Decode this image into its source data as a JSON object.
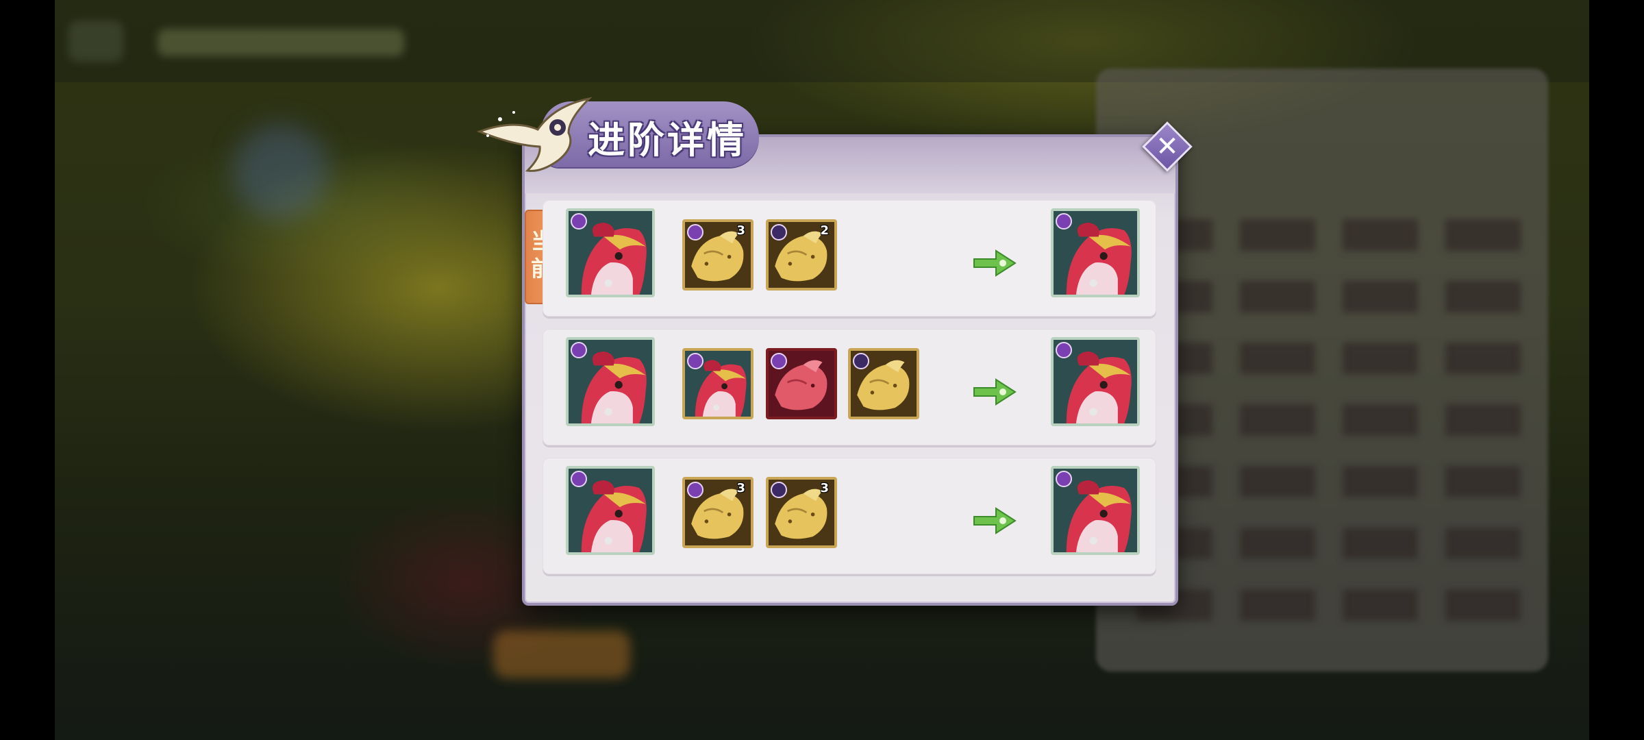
{
  "dialog": {
    "title": "进阶详情",
    "current_tag": "当前",
    "close_icon": "close-x-icon"
  },
  "rows": [
    {
      "is_current": true,
      "source_pet": "red-hood-bird-pet",
      "materials": [
        {
          "item": "gold-spirit-fox",
          "count": "3",
          "badge": "heart-badge"
        },
        {
          "item": "gold-spirit-fox",
          "count": "2",
          "badge": "star-badge"
        }
      ],
      "result_pet": "red-hood-bird-pet"
    },
    {
      "is_current": false,
      "source_pet": "red-hood-bird-pet",
      "materials": [
        {
          "item": "red-hood-bird-pet",
          "count": "",
          "badge": "heart-badge"
        },
        {
          "item": "red-spirit-fox",
          "count": "",
          "badge": "heart-badge"
        },
        {
          "item": "gold-spirit-fox",
          "count": "",
          "badge": "star-badge"
        }
      ],
      "result_pet": "red-hood-bird-pet"
    },
    {
      "is_current": false,
      "source_pet": "red-hood-bird-pet",
      "materials": [
        {
          "item": "gold-spirit-fox",
          "count": "3",
          "badge": "heart-badge"
        },
        {
          "item": "gold-spirit-fox",
          "count": "3",
          "badge": "star-badge"
        }
      ],
      "result_pet": "red-hood-bird-pet"
    }
  ],
  "colors": {
    "accent_purple": "#7d6aa8",
    "current_tag_orange": "#f19a5c",
    "arrow_green": "#6cc24a",
    "gold_frame": "#c8a655"
  }
}
